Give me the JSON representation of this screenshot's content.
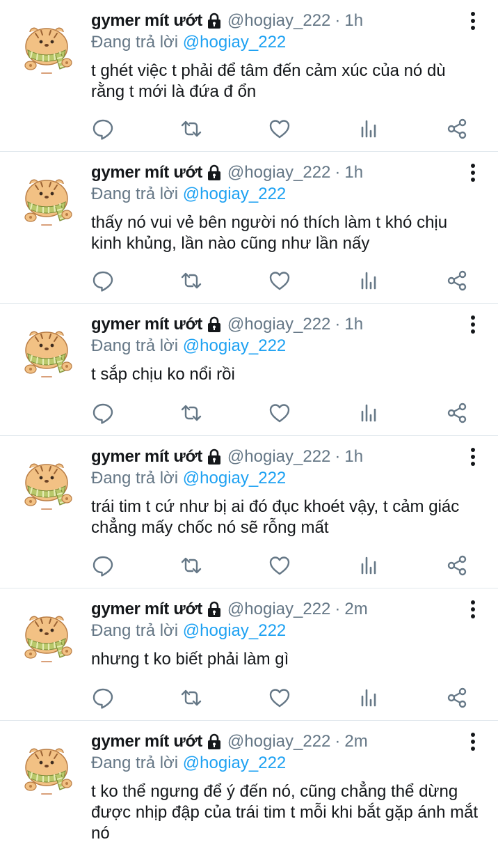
{
  "colors": {
    "text": "#14171a",
    "secondary": "#657786",
    "mention": "#1da1f2",
    "divider": "#e1e8ed",
    "action_icon": "#657786"
  },
  "icons": {
    "avatar": "tiger-with-scarf-avatar",
    "lock": "lock-icon",
    "more": "more-vertical-icon",
    "reply": "reply-bubble-icon",
    "retweet": "retweet-icon",
    "like": "heart-icon",
    "stats": "analytics-bars-icon",
    "share": "share-icon"
  },
  "tweets": [
    {
      "name": "gymer mít ướt",
      "handle": "@hogiay_222",
      "separator": "·",
      "time": "1h",
      "reply_prefix": "Đang trả lời ",
      "reply_to": "@hogiay_222",
      "text": "t ghét việc t phải để tâm đến cảm xúc của nó dù rằng t mới là đứa đ ổn"
    },
    {
      "name": "gymer mít ướt",
      "handle": "@hogiay_222",
      "separator": "·",
      "time": "1h",
      "reply_prefix": "Đang trả lời ",
      "reply_to": "@hogiay_222",
      "text": "thấy nó vui vẻ bên người nó thích làm t khó chịu kinh khủng, lần nào cũng như lần nấy"
    },
    {
      "name": "gymer mít ướt",
      "handle": "@hogiay_222",
      "separator": "·",
      "time": "1h",
      "reply_prefix": "Đang trả lời ",
      "reply_to": "@hogiay_222",
      "text": "t sắp chịu ko nổi rồi"
    },
    {
      "name": "gymer mít ướt",
      "handle": "@hogiay_222",
      "separator": "·",
      "time": "1h",
      "reply_prefix": "Đang trả lời ",
      "reply_to": "@hogiay_222",
      "text": "trái tim t cứ như bị ai đó đục khoét vậy, t cảm giác chẳng mấy chốc nó sẽ rỗng mất"
    },
    {
      "name": "gymer mít ướt",
      "handle": "@hogiay_222",
      "separator": "·",
      "time": "2m",
      "reply_prefix": "Đang trả lời ",
      "reply_to": "@hogiay_222",
      "text": "nhưng t ko biết phải làm gì"
    },
    {
      "name": "gymer mít ướt",
      "handle": "@hogiay_222",
      "separator": "·",
      "time": "2m",
      "reply_prefix": "Đang trả lời ",
      "reply_to": "@hogiay_222",
      "text": "t ko thể ngưng để ý đến nó, cũng chẳng thể dừng được nhịp đập của trái tim t mỗi khi bắt gặp ánh mắt nó"
    }
  ]
}
